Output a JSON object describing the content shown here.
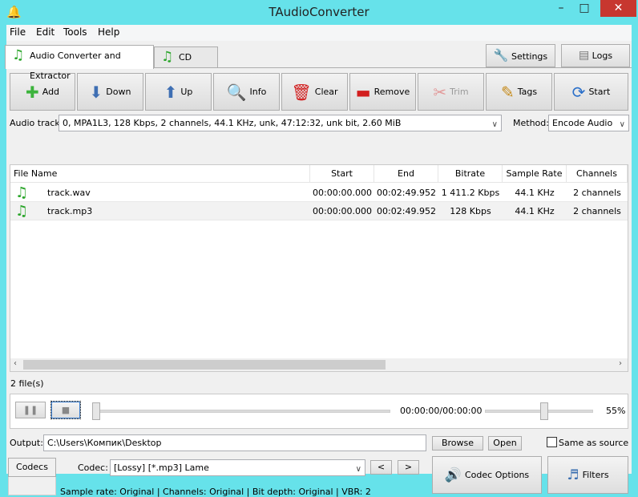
{
  "window": {
    "title": "TAudioConverter",
    "minimize": "–",
    "maximize": "□",
    "close": "✕"
  },
  "menu": [
    "File",
    "Edit",
    "Tools",
    "Help"
  ],
  "tabs": [
    {
      "label": "Audio Converter and Extractor",
      "active": true
    },
    {
      "label": "CD Ripper",
      "active": false
    }
  ],
  "top_buttons": {
    "settings": "Settings",
    "logs": "Logs"
  },
  "toolbar": [
    {
      "label": "Add",
      "icon": "plus-icon",
      "glyph": "✚",
      "color": "#3cb33c",
      "enabled": true
    },
    {
      "label": "Down",
      "icon": "arrow-down-icon",
      "glyph": "⬇",
      "color": "#3f6fb3",
      "enabled": true
    },
    {
      "label": "Up",
      "icon": "arrow-up-icon",
      "glyph": "⬆",
      "color": "#3f6fb3",
      "enabled": true
    },
    {
      "label": "Info",
      "icon": "magnifier-icon",
      "glyph": "🔍",
      "color": "#7aa7c7",
      "enabled": true
    },
    {
      "label": "Clear",
      "icon": "trash-icon",
      "glyph": "🗑",
      "color": "#d21e1e",
      "enabled": true
    },
    {
      "label": "Remove",
      "icon": "minus-icon",
      "glyph": "▬",
      "color": "#d21e1e",
      "enabled": true
    },
    {
      "label": "Trim",
      "icon": "scissors-icon",
      "glyph": "✂",
      "color": "#e29a9a",
      "enabled": false
    },
    {
      "label": "Tags",
      "icon": "pencil-icon",
      "glyph": "✎",
      "color": "#c58a1a",
      "enabled": true
    },
    {
      "label": "Start",
      "icon": "refresh-icon",
      "glyph": "⟳",
      "color": "#2a6fc9",
      "enabled": true
    }
  ],
  "audio_track": {
    "label": "Audio track:",
    "value": "0, MPA1L3, 128 Kbps, 2 channels, 44.1 KHz, unk, 47:12:32, unk bit, 2.60 MiB"
  },
  "method": {
    "label": "Method:",
    "value": "Encode Audio"
  },
  "table": {
    "columns": [
      "File Name",
      "Start",
      "End",
      "Bitrate",
      "Sample Rate",
      "Channels"
    ],
    "rows": [
      [
        "track.wav",
        "00:00:00.000",
        "00:02:49.952",
        "1 411.2 Kbps",
        "44.1 KHz",
        "2 channels"
      ],
      [
        "track.mp3",
        "00:00:00.000",
        "00:02:49.952",
        "128 Kbps",
        "44.1 KHz",
        "2 channels"
      ]
    ]
  },
  "file_count": "2 file(s)",
  "player": {
    "time": "00:00:00/00:00:00",
    "volume": "55%",
    "volume_value": 55,
    "position": 0
  },
  "output": {
    "label": "Output:",
    "value": "C:\\Users\\Компик\\Desktop",
    "browse": "Browse",
    "open": "Open",
    "same_as_source": "Same as source",
    "same_as_source_checked": false
  },
  "codec": {
    "tab": "Codecs",
    "label": "Codec:",
    "value": "[Lossy] [*.mp3] Lame",
    "prev": "<",
    "next": ">",
    "info": "Sample rate: Original | Channels: Original | Bit depth: Original | VBR: 2",
    "options": "Codec Options",
    "filters": "Filters"
  }
}
